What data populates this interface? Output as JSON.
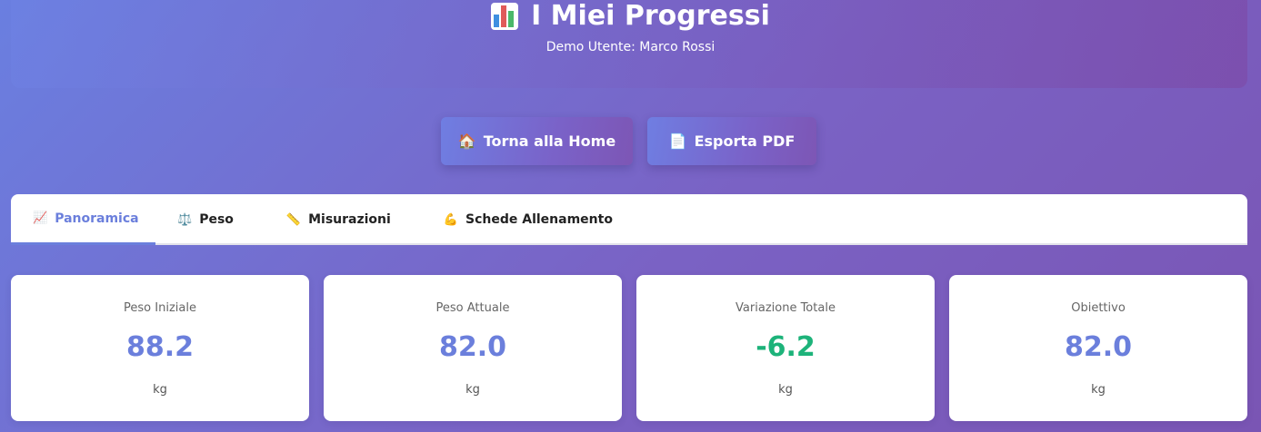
{
  "header": {
    "title": "I Miei Progressi",
    "title_icon": "bar-chart-icon",
    "subtitle": "Demo Utente: Marco Rossi"
  },
  "actions": {
    "home_label": "Torna alla Home",
    "home_icon": "house-icon",
    "pdf_label": "Esporta PDF",
    "pdf_icon": "document-icon"
  },
  "tabs": [
    {
      "label": "Panoramica",
      "icon": "chart-up-icon",
      "active": true
    },
    {
      "label": "Peso",
      "icon": "scale-icon",
      "active": false
    },
    {
      "label": "Misurazioni",
      "icon": "ruler-icon",
      "active": false
    },
    {
      "label": "Schede Allenamento",
      "icon": "flexed-biceps-icon",
      "active": false
    }
  ],
  "stats": [
    {
      "label": "Peso Iniziale",
      "value": "88.2",
      "unit": "kg"
    },
    {
      "label": "Peso Attuale",
      "value": "82.0",
      "unit": "kg"
    },
    {
      "label": "Variazione Totale",
      "value": "-6.2",
      "unit": "kg"
    },
    {
      "label": "Obiettivo",
      "value": "82.0",
      "unit": "kg"
    }
  ],
  "colors": {
    "accent": "#6b7fdc",
    "positive": "#1db37a",
    "background_start": "#6a7fe0",
    "background_end": "#7a55b4"
  }
}
